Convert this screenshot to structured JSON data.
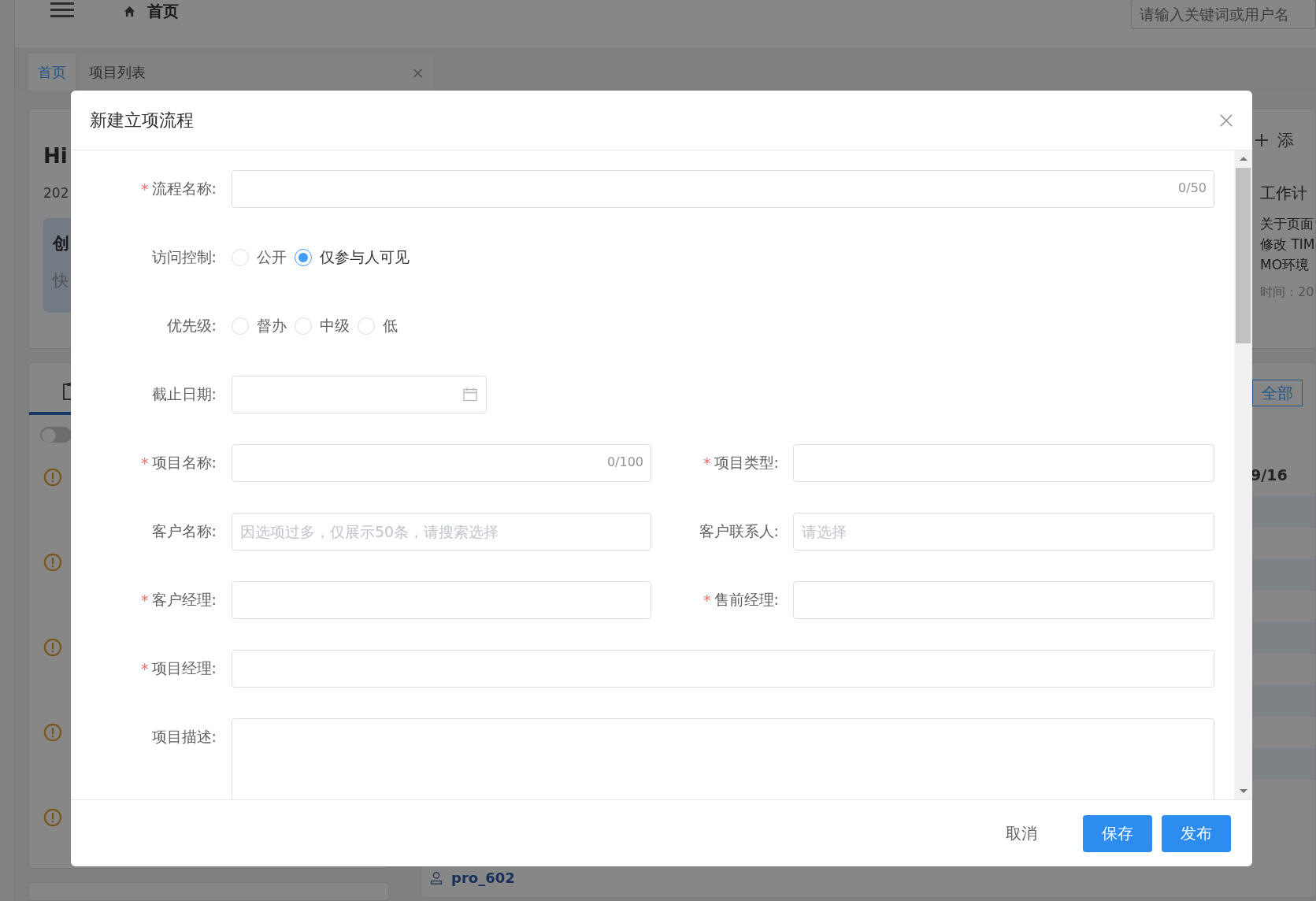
{
  "header": {
    "breadcrumb": "首页",
    "search_placeholder": "请输入关键词或用户名"
  },
  "tabs": [
    {
      "label": "首页",
      "selected": true
    },
    {
      "label": "项目列表",
      "selected": false,
      "close": "×"
    }
  ],
  "left_panel": {
    "greeting": "Hi",
    "date": "202",
    "shortcut_title": "创",
    "shortcut_text": "快",
    "switch_on": false
  },
  "right_panel": {
    "add_text": "添",
    "notice_title": "工作计",
    "notice_lines": [
      "关于页面",
      "修改 TIM",
      "MO环境"
    ],
    "notice_time": "时间：20",
    "filter_button": "全部",
    "page_label": "9/16",
    "user": "pro_602"
  },
  "dialog": {
    "title": "新建立项流程",
    "rows": [
      [
        {
          "kind": "text",
          "label": "流程名称:",
          "required_mark": "*",
          "counter": "0/50"
        }
      ],
      [
        {
          "kind": "radio",
          "label": "访问控制:",
          "options": [
            {
              "label": "公开",
              "selected": false
            },
            {
              "label": "仅参与人可见",
              "selected": true
            }
          ]
        }
      ],
      [
        {
          "kind": "radio",
          "label": "优先级:",
          "options": [
            {
              "label": "督办",
              "selected": false
            },
            {
              "label": "中级",
              "selected": false
            },
            {
              "label": "低",
              "selected": false
            }
          ]
        }
      ],
      [
        {
          "kind": "date",
          "label": "截止日期:"
        }
      ],
      [
        {
          "kind": "text",
          "label": "项目名称:",
          "required_mark": "*",
          "counter": "0/100"
        },
        {
          "kind": "text",
          "label": "项目类型:",
          "required_mark": "*"
        }
      ],
      [
        {
          "kind": "text",
          "label": "客户名称:",
          "placeholder": "因选项过多，仅展示50条，请搜索选择"
        },
        {
          "kind": "text",
          "label": "客户联系人:",
          "placeholder": "请选择"
        }
      ],
      [
        {
          "kind": "text",
          "label": "客户经理:",
          "required_mark": "*"
        },
        {
          "kind": "text",
          "label": "售前经理:",
          "required_mark": "*"
        }
      ],
      [
        {
          "kind": "text",
          "label": "项目经理:",
          "required_mark": "*"
        }
      ],
      [
        {
          "kind": "textarea",
          "label": "项目描述:"
        }
      ]
    ],
    "buttons": [
      {
        "label": "取消",
        "kind": "text"
      },
      {
        "label": "保存",
        "kind": "primary"
      },
      {
        "label": "发布",
        "kind": "primary"
      }
    ]
  }
}
